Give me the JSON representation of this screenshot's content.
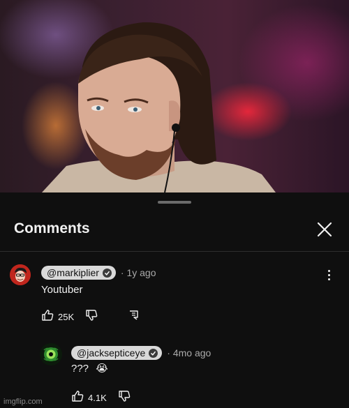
{
  "sheet": {
    "title": "Comments"
  },
  "comments": [
    {
      "handle": "@markiplier",
      "age": "1y ago",
      "text": "Youtuber",
      "likes": "25K"
    },
    {
      "handle": "@jacksepticeye",
      "age": "4mo ago",
      "text": "???",
      "emoji": "😭",
      "likes": "4.1K"
    }
  ],
  "watermark": "imgflip.com",
  "icons": {
    "close": "close-icon",
    "like": "thumbs-up-icon",
    "dislike": "thumbs-down-icon",
    "reply": "reply-icon",
    "more": "more-vertical-icon",
    "verified": "verified-check-icon"
  },
  "colors": {
    "sheet_bg": "#0f0f0f",
    "text": "#f1f1f1",
    "muted": "#aaaaaa",
    "pill": "#d9d9d9"
  }
}
